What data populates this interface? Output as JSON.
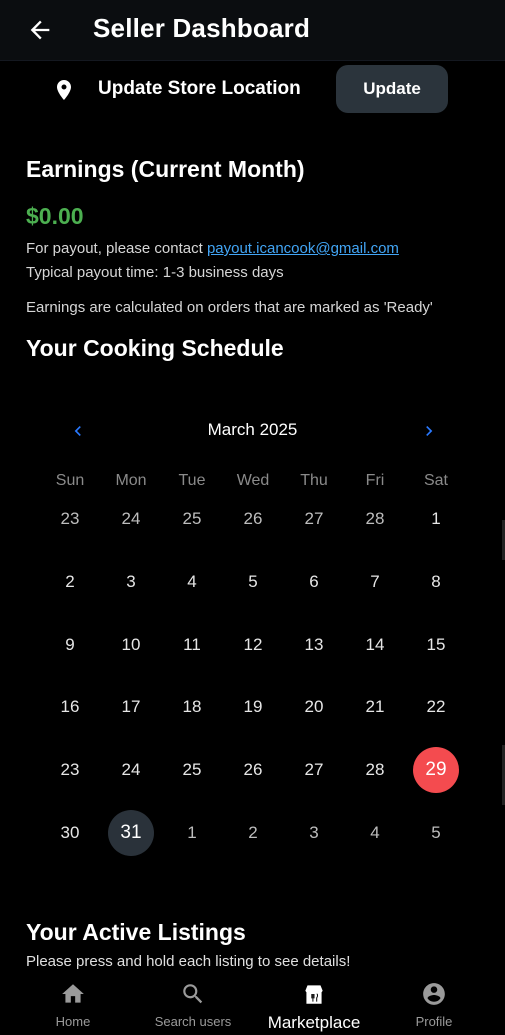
{
  "appbar": {
    "title": "Seller Dashboard"
  },
  "location": {
    "label": "Update Store Location",
    "button": "Update"
  },
  "earnings": {
    "heading": "Earnings (Current Month)",
    "amount": "$0.00",
    "contact_prefix": "For payout, please contact ",
    "contact_email": "payout.icancook@gmail.com",
    "payout_time": "Typical payout time: 1-3 business days",
    "note": "Earnings are calculated on orders that are marked as 'Ready'"
  },
  "schedule": {
    "heading": "Your Cooking Schedule",
    "month_label": "March 2025",
    "weekdays": [
      "Sun",
      "Mon",
      "Tue",
      "Wed",
      "Thu",
      "Fri",
      "Sat"
    ],
    "weeks": [
      [
        "23",
        "24",
        "25",
        "26",
        "27",
        "28",
        "1"
      ],
      [
        "2",
        "3",
        "4",
        "5",
        "6",
        "7",
        "8"
      ],
      [
        "9",
        "10",
        "11",
        "12",
        "13",
        "14",
        "15"
      ],
      [
        "16",
        "17",
        "18",
        "19",
        "20",
        "21",
        "22"
      ],
      [
        "23",
        "24",
        "25",
        "26",
        "27",
        "28",
        "29"
      ],
      [
        "30",
        "31",
        "1",
        "2",
        "3",
        "4",
        "5"
      ]
    ],
    "selected_day": "29",
    "today_day": "31",
    "colors": {
      "selected": "#f44b4f",
      "today": "#2a323a",
      "nav_arrow": "#2979ff"
    }
  },
  "listings": {
    "heading": "Your Active Listings",
    "hint": "Please press and hold each listing to see details!"
  },
  "bottom_nav": [
    {
      "label": "Home",
      "icon": "home-icon"
    },
    {
      "label": "Search users",
      "icon": "search-icon"
    },
    {
      "label": "Marketplace",
      "icon": "storefront-icon"
    },
    {
      "label": "Profile",
      "icon": "account-circle-icon"
    }
  ],
  "accent": {
    "earnings_green": "#4caf50",
    "link_blue": "#42a5f5"
  }
}
